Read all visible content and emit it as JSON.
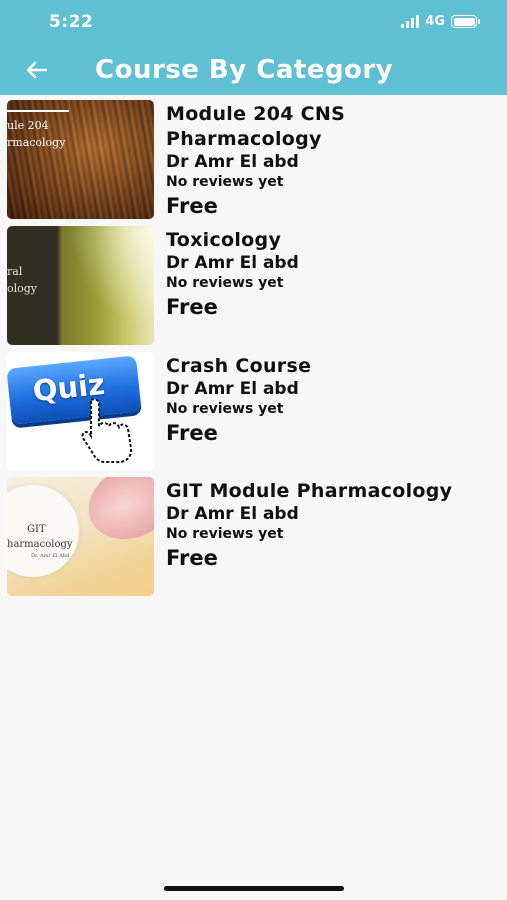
{
  "status": {
    "time": "5:22",
    "network": "4G"
  },
  "header": {
    "title": "Course By Category",
    "back_icon": "arrow-left-icon"
  },
  "colors": {
    "header": "#5fc0d4",
    "background": "#f7f7f7",
    "text": "#111111"
  },
  "courses": [
    {
      "title": "Module 204  CNS Pharmacology",
      "instructor": "Dr Amr El abd",
      "reviews": "No reviews yet",
      "price": "Free",
      "thumb_lines": [
        "ule 204",
        "rmacology"
      ]
    },
    {
      "title": "Toxicology",
      "instructor": "Dr Amr El abd",
      "reviews": "No reviews yet",
      "price": "Free",
      "thumb_lines": [
        "ral",
        "ology"
      ]
    },
    {
      "title": "Crash Course",
      "instructor": "Dr Amr El abd",
      "reviews": "No reviews yet",
      "price": "Free",
      "thumb_lines": [
        "Quiz"
      ]
    },
    {
      "title": "GIT Module Pharmacology",
      "instructor": "Dr Amr El abd",
      "reviews": "No reviews yet",
      "price": "Free",
      "thumb_lines": [
        "GIT",
        "harmacology",
        "Dr. Amr El Abd"
      ]
    }
  ]
}
